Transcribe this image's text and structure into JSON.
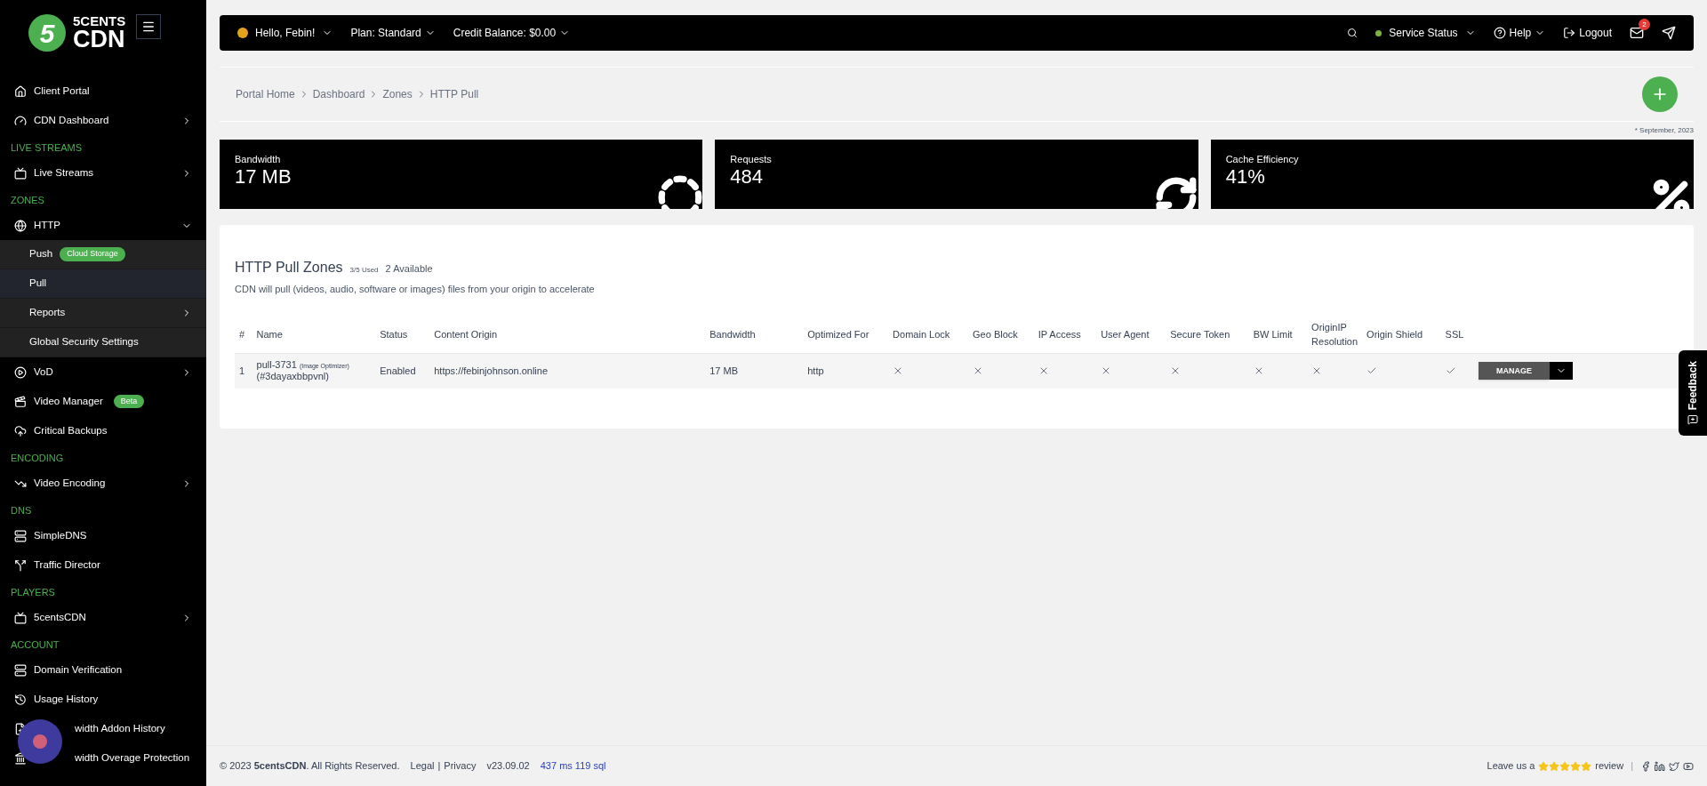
{
  "brand": {
    "top": "5CENTS",
    "bottom": "CDN",
    "mark": "5"
  },
  "sidebar": [
    {
      "kind": "item",
      "label": "Client Portal"
    },
    {
      "kind": "item",
      "label": "CDN Dashboard",
      "expanded": false
    },
    {
      "kind": "section",
      "label": "LIVE STREAMS"
    },
    {
      "kind": "item",
      "label": "Live Streams",
      "expanded": false
    },
    {
      "kind": "section",
      "label": "ZONES"
    },
    {
      "kind": "item",
      "label": "HTTP",
      "expanded": true
    },
    {
      "kind": "subitem",
      "label": "Push",
      "badge": "Cloud Storage",
      "selected": false
    },
    {
      "kind": "subitem",
      "label": "Pull",
      "selected": true
    },
    {
      "kind": "subitem",
      "label": "Reports",
      "selected": false,
      "expanded": false
    },
    {
      "kind": "subitem",
      "label": "Global Security Settings",
      "selected": false
    },
    {
      "kind": "item",
      "label": "VoD",
      "expanded": false
    },
    {
      "kind": "item",
      "label": "Video Manager",
      "badge": "Beta"
    },
    {
      "kind": "item",
      "label": "Critical Backups"
    },
    {
      "kind": "section",
      "label": "ENCODING"
    },
    {
      "kind": "item",
      "label": "Video Encoding",
      "expanded": false
    },
    {
      "kind": "section",
      "label": "DNS"
    },
    {
      "kind": "item",
      "label": "SimpleDNS"
    },
    {
      "kind": "item",
      "label": "Traffic Director"
    },
    {
      "kind": "section",
      "label": "PLAYERS"
    },
    {
      "kind": "item",
      "label": "5centsCDN",
      "expanded": false
    },
    {
      "kind": "section",
      "label": "ACCOUNT"
    },
    {
      "kind": "item",
      "label": "Domain Verification"
    },
    {
      "kind": "item",
      "label": "Usage History"
    },
    {
      "kind": "item",
      "label": "width Addon History",
      "covered": true
    },
    {
      "kind": "item",
      "label": "width Overage Protection",
      "covered": true
    }
  ],
  "topbar": {
    "greeting": "Hello, Febin!",
    "plan": "Plan: Standard",
    "credit": "Credit Balance: $0.00",
    "service_status": {
      "label": "Service Status",
      "color": "#7cb342"
    },
    "help": "Help",
    "logout": "Logout",
    "mail_count": "2"
  },
  "breadcrumb": [
    "Portal Home",
    "Dashboard",
    "Zones",
    "HTTP Pull"
  ],
  "period_note": "* September, 2023",
  "stats": [
    {
      "label": "Bandwidth",
      "value": "17 MB"
    },
    {
      "label": "Requests",
      "value": "484"
    },
    {
      "label": "Cache Efficiency",
      "value": "41%"
    }
  ],
  "zones": {
    "title": "HTTP Pull Zones",
    "used": "3/5 Used",
    "available": "2 Available",
    "description": "CDN will pull (videos, audio, software or images) files from your origin to accelerate",
    "columns": [
      "#",
      "Name",
      "Status",
      "Content Origin",
      "Bandwidth",
      "Optimized For",
      "Domain Lock",
      "Geo Block",
      "IP Access",
      "User Agent",
      "Secure Token",
      "BW Limit",
      "OriginIP Resolution",
      "Origin Shield",
      "SSL"
    ],
    "rows": [
      {
        "index": "1",
        "name": "pull-3731",
        "tag": "(Image Optimizer)",
        "id": "(#3dayaxbbpvnl)",
        "status": "Enabled",
        "origin": "https://febinjohnson.online",
        "bandwidth": "17 MB",
        "optimized_for": "http",
        "features": [
          false,
          false,
          false,
          false,
          false,
          false,
          false,
          true,
          true
        ],
        "action": "MANAGE"
      }
    ]
  },
  "feedback": "Feedback",
  "footer": {
    "copyright": "© 2023 ",
    "company": "5centsCDN",
    "rights": ". All Rights Reserved.",
    "legal": "Legal",
    "link_separator": "|",
    "privacy": "Privacy",
    "social_separator": "|",
    "version": "v23.09.02",
    "timing": "437 ms 119 sql",
    "review_prefix": "Leave us a",
    "stars": 5,
    "review_suffix": "review"
  }
}
